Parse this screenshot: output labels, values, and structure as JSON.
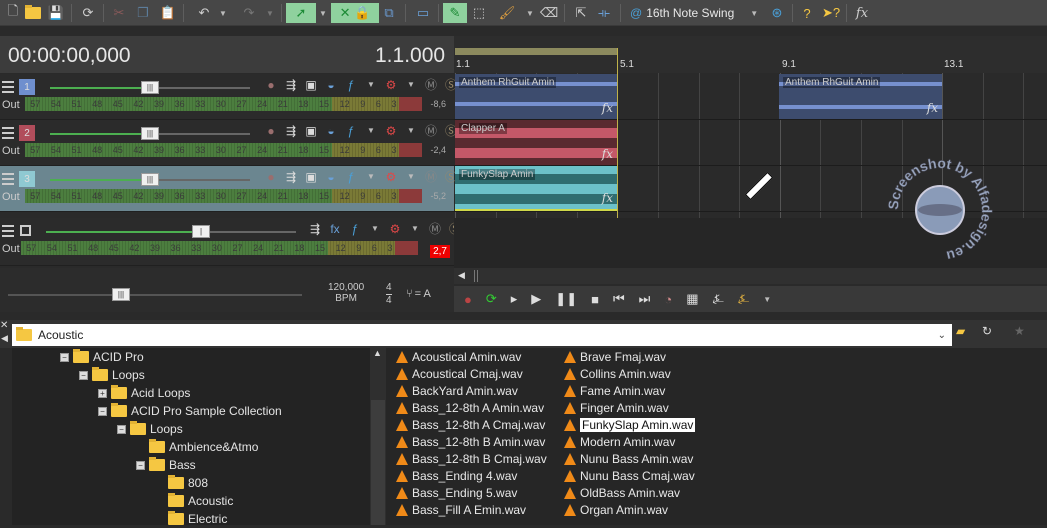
{
  "toolbar": {
    "icons": [
      "new-file",
      "open-folder",
      "save",
      "refresh",
      "cut",
      "copy",
      "paste",
      "undo",
      "undo-dropdown",
      "redo",
      "redo-dropdown",
      "envelope-tool",
      "envelope-tool-dropdown",
      "auto-crossfade",
      "lock-envelopes",
      "snap-to-grid",
      "ignore-event-grouping",
      "draw-tool",
      "select-tool",
      "paint-tool",
      "paint-tool-dropdown",
      "erase-tool",
      "split-tool",
      "trim-tool"
    ],
    "groove": "16th Note Swing",
    "right_icons": [
      "groove-editor",
      "help-what-is",
      "context-help",
      "insert-fx"
    ]
  },
  "timedisplay": {
    "timecode": "00:00:00,000",
    "beat": "1.1.000"
  },
  "tracks": [
    {
      "number": "1",
      "color": "#6f8fce",
      "peak": "-8,6",
      "clip_name": "Anthem RhGuit Amin",
      "clip_color": "#3d4c6e",
      "wave_color": "#7690cf"
    },
    {
      "number": "2",
      "color": "#b14d5b",
      "peak": "-2,4",
      "clip_name": "Clapper A",
      "clip_color": "#5a2a30",
      "wave_color": "#c45868"
    },
    {
      "number": "3",
      "color": "#8fc9d2",
      "peak": "-5,2",
      "clip_name": "FunkySlap Amin",
      "clip_color": "#6cc1c9",
      "wave_color": "#2f6d70"
    }
  ],
  "meter_labels": [
    "57",
    "54",
    "51",
    "48",
    "45",
    "42",
    "39",
    "36",
    "33",
    "30",
    "27",
    "24",
    "21",
    "18",
    "15",
    "12",
    "9",
    "6",
    "3"
  ],
  "out_label": "Out",
  "master": {
    "peak": "2,7",
    "fader_level": 0.62
  },
  "track_fader_level": 0.5,
  "tempo": {
    "bpm": "120,000",
    "bpm_label": "BPM",
    "ts_top": "4",
    "ts_bottom": "4",
    "key": "= A"
  },
  "ruler": [
    "1.1",
    "5.1",
    "9.1",
    "13.1"
  ],
  "clip2": {
    "name": "Anthem RhGuit Amin"
  },
  "fx_label": "fx",
  "transport": [
    "record",
    "loop",
    "play-from-start",
    "play",
    "pause",
    "stop",
    "go-to-start",
    "go-to-end",
    "metronome",
    "marker",
    "tempo-tap",
    "tempo-tap-2"
  ],
  "explorer": {
    "path": "Acoustic",
    "tree": [
      {
        "label": "ACID Pro",
        "level": 0,
        "exp": "-"
      },
      {
        "label": "Loops",
        "level": 1,
        "exp": "-"
      },
      {
        "label": "Acid Loops",
        "level": 2,
        "exp": "+"
      },
      {
        "label": "ACID Pro Sample Collection",
        "level": 2,
        "exp": "-"
      },
      {
        "label": "Loops",
        "level": 3,
        "exp": "-"
      },
      {
        "label": "Ambience&Atmo",
        "level": 4,
        "exp": ""
      },
      {
        "label": "Bass",
        "level": 4,
        "exp": "-"
      },
      {
        "label": "808",
        "level": 5,
        "exp": ""
      },
      {
        "label": "Acoustic",
        "level": 5,
        "exp": ""
      },
      {
        "label": "Electric",
        "level": 5,
        "exp": ""
      }
    ],
    "files_col1": [
      "Acoustical Amin.wav",
      "Acoustical Cmaj.wav",
      "BackYard Amin.wav",
      "Bass_12-8th A Amin.wav",
      "Bass_12-8th A Cmaj.wav",
      "Bass_12-8th B Amin.wav",
      "Bass_12-8th B Cmaj.wav",
      "Bass_Ending 4.wav",
      "Bass_Ending 5.wav",
      "Bass_Fill A Emin.wav"
    ],
    "files_col2": [
      "Brave Fmaj.wav",
      "Collins Amin.wav",
      "Fame Amin.wav",
      "Finger Amin.wav",
      "FunkySlap Amin.wav",
      "Modern Amin.wav",
      "Nunu Bass Amin.wav",
      "Nunu Bass Cmaj.wav",
      "OldBass Amin.wav",
      "Organ Amin.wav"
    ],
    "selected_file": "FunkySlap Amin.wav"
  },
  "watermark": "Screenshot by Alfadesign.eu"
}
